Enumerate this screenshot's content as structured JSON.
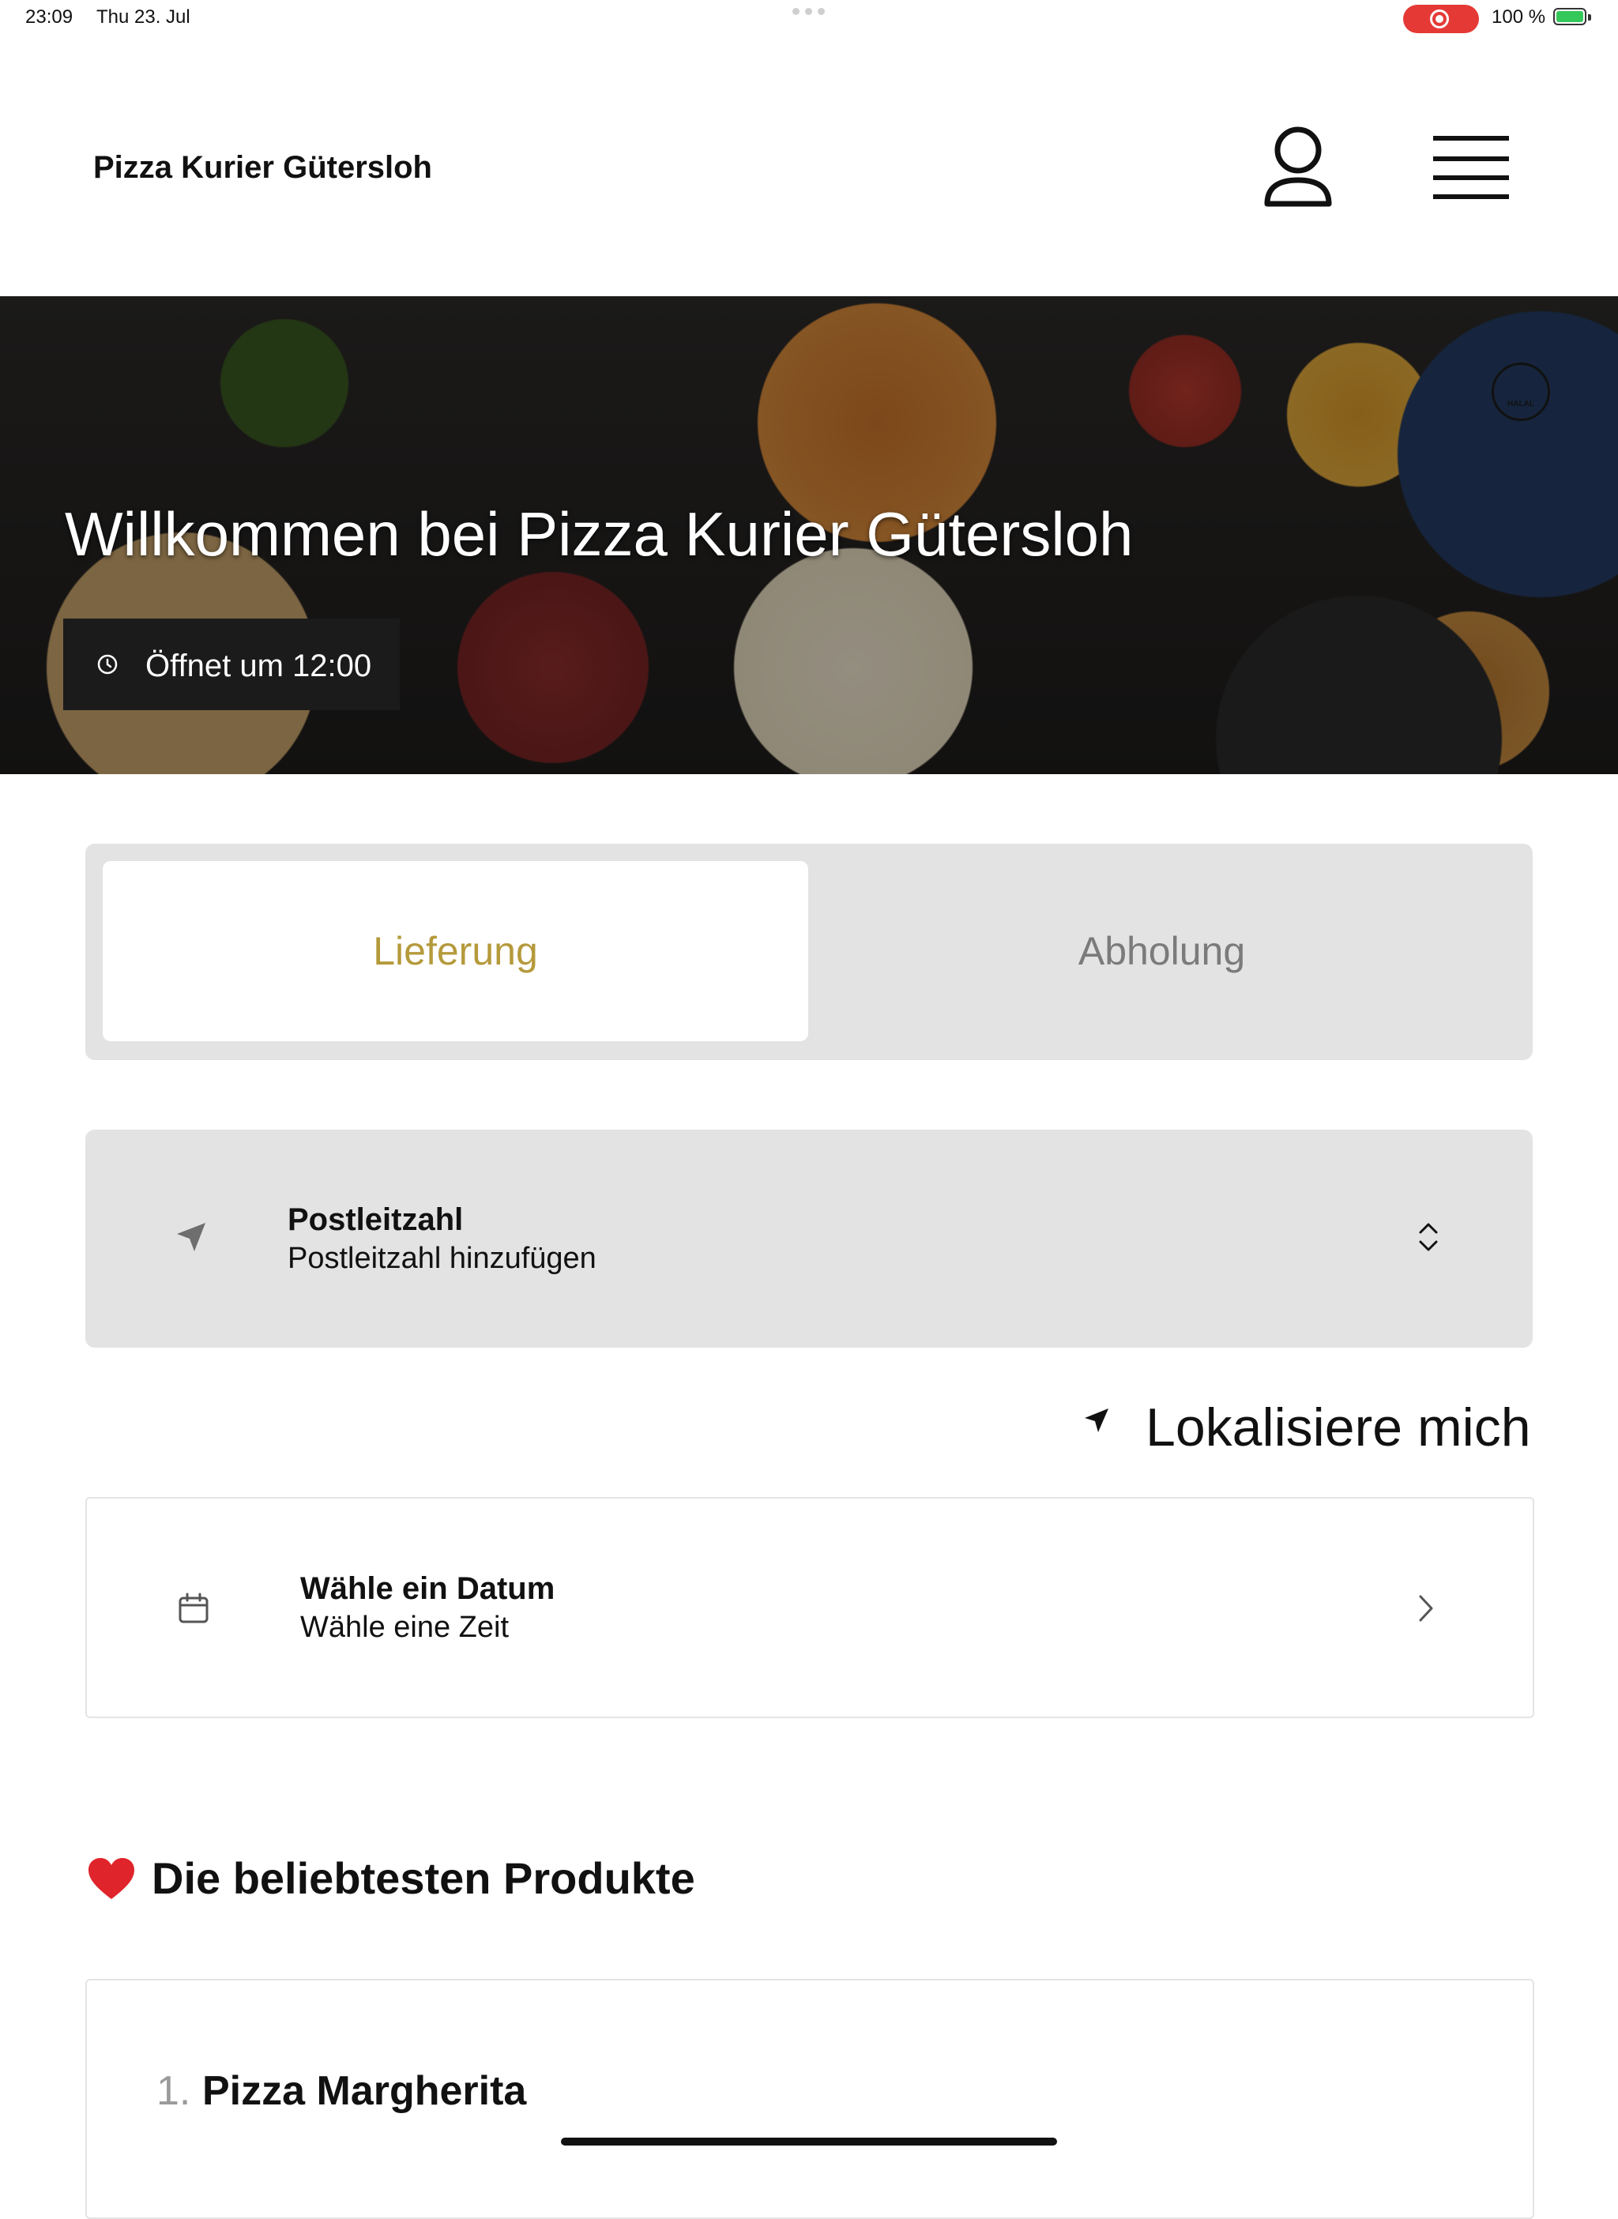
{
  "status_bar": {
    "time": "23:09",
    "date": "Thu 23. Jul",
    "battery_percent": "100 %",
    "recording_color": "#e53935",
    "battery_color": "#34c759"
  },
  "header": {
    "title": "Pizza Kurier Gütersloh",
    "account_icon": "user-icon",
    "menu_icon": "hamburger-menu-icon"
  },
  "hero": {
    "title": "Willkommen bei Pizza Kurier Gütersloh",
    "opening_text": "Öffnet um 12:00",
    "opening_icon": "clock-icon"
  },
  "order_mode": {
    "options": [
      "Lieferung",
      "Abholung"
    ],
    "selected": "Lieferung",
    "active_color": "#b59a3c",
    "inactive_color": "#7b7b7b"
  },
  "postcode": {
    "label": "Postleitzahl",
    "placeholder": "Postleitzahl hinzufügen",
    "icon": "location-arrow-icon",
    "chevron": "chevron-up-down-icon"
  },
  "localize": {
    "label": "Lokalisiere mich",
    "icon": "location-arrow-icon"
  },
  "schedule": {
    "label": "Wähle ein Datum",
    "sublabel": "Wähle eine Zeit",
    "icon": "calendar-icon",
    "chevron": "chevron-right-icon"
  },
  "popular": {
    "title": "Die beliebtesten Produkte",
    "icon": "heart-icon",
    "items": [
      {
        "rank": "1.",
        "name": "Pizza Margherita"
      }
    ]
  }
}
